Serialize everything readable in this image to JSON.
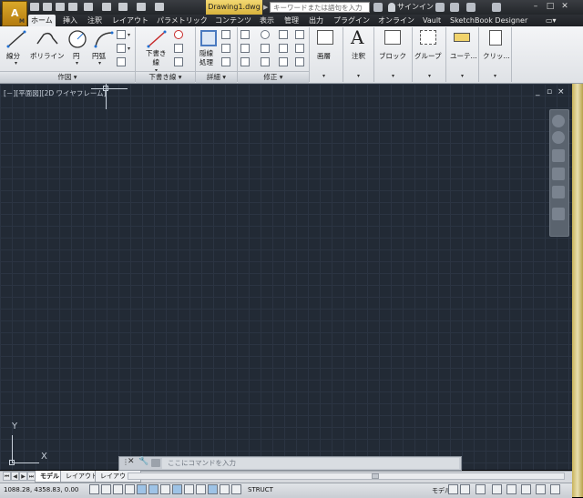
{
  "titlebar": {
    "app_logo_letter": "A",
    "app_logo_sub": "M",
    "document_tab": "Drawing1.dwg",
    "search_placeholder": "キーワードまたは語句を入力",
    "signin": "サインイン",
    "window_buttons": [
      "–",
      "□",
      "✕"
    ]
  },
  "ribbon_tabs": [
    "ホーム",
    "挿入",
    "注釈",
    "レイアウト",
    "パラメトリック",
    "コンテンツ",
    "表示",
    "管理",
    "出力",
    "プラグイン",
    "オンライン",
    "Vault",
    "SketchBook Designer"
  ],
  "ribbon_active_tab": 0,
  "ribbon": {
    "draw": {
      "tools": [
        "線分",
        "ポリライン",
        "円",
        "円弧"
      ],
      "panel_label": "作図"
    },
    "draft": {
      "tool": "下書き\n線",
      "panel_label": "下書き線"
    },
    "detail": {
      "tool": "隠線\n処理",
      "panel_label": "詳細"
    },
    "modify": {
      "panel_label": "修正"
    },
    "big_buttons": [
      "画層",
      "注釈",
      "ブロック",
      "グループ",
      "ユーテ...",
      "クリッ..."
    ]
  },
  "viewport": {
    "label": "[－][平面図][2D ワイヤフレーム]",
    "controls": [
      "_",
      "▫",
      "×"
    ],
    "ucs_x": "X",
    "ucs_y": "Y"
  },
  "command_line": {
    "placeholder": "ここにコマンドを入力"
  },
  "layout_tabs": [
    "モデル",
    "レイアウト1",
    "レイアウト2"
  ],
  "layout_active": 0,
  "status": {
    "coords": "1088.28, 4358.83, 0.00",
    "struct": "STRUCT",
    "model": "モデル"
  },
  "colors": {
    "drawing_bg": "#222a35",
    "grid": "#2b3442",
    "doc_tab": "#e0bd4a"
  }
}
